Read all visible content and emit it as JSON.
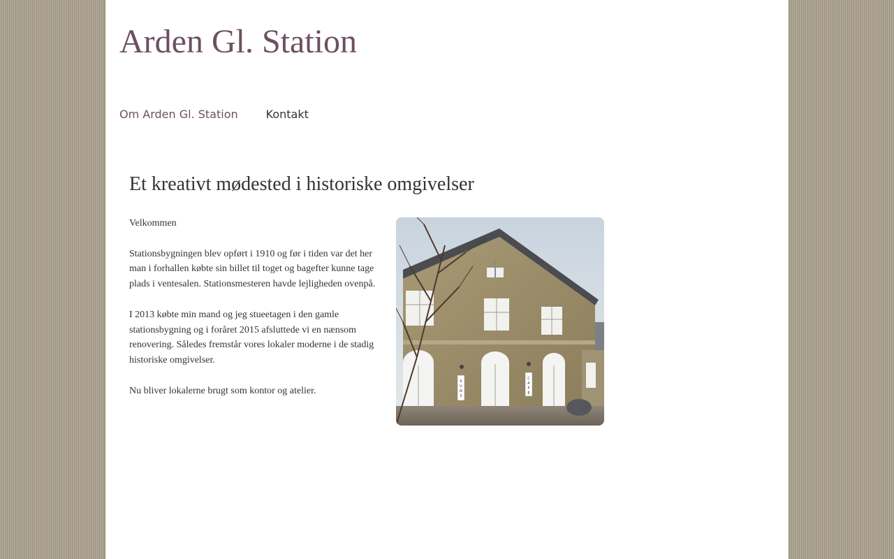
{
  "header": {
    "site_title": "Arden Gl. Station"
  },
  "nav": {
    "items": [
      {
        "label": "Om Arden Gl. Station",
        "active": true
      },
      {
        "label": "Kontakt",
        "active": false
      }
    ]
  },
  "main": {
    "headline": "Et kreativt mødested i historiske omgivelser",
    "paragraphs": [
      "Velkommen",
      "Stationsbygningen blev opført i 1910 og før i tiden var det her man i forhallen købte sin billet til toget og bagefter kunne tage plads i ventesalen. Stationsmesteren havde lejligheden ovenpå.",
      "I 2013 købte min mand og jeg stueetagen i den gamle stationsbygning og i foråret 2015 afsluttede vi en nænsom renovering. Således fremstår vores lokaler moderne i de stadig historiske omgivelser.",
      "Nu bliver lokalerne brugt som kontor og atelier."
    ],
    "photo": {
      "signs": [
        "KUNST",
        "CAFE"
      ]
    }
  },
  "colors": {
    "accent": "#6e4f60",
    "text": "#333333",
    "background_stripes": "#a9a08f"
  }
}
